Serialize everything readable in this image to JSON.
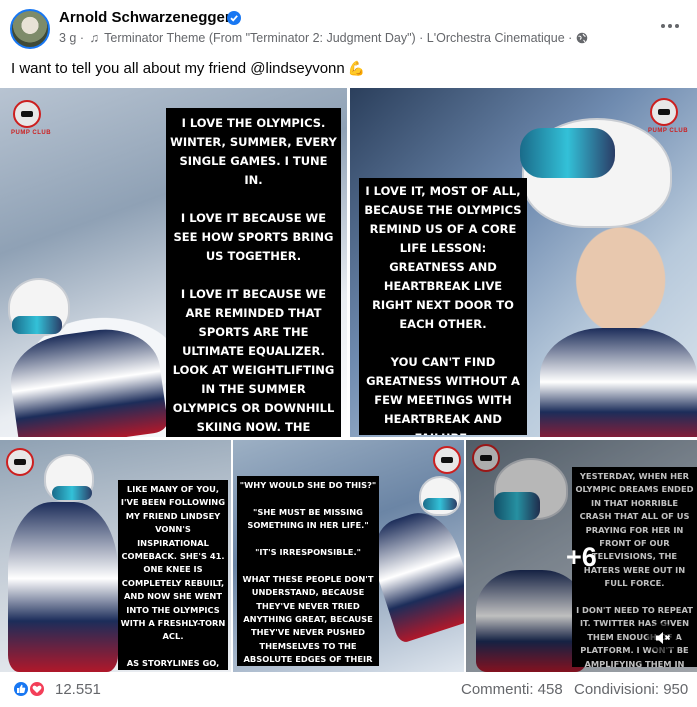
{
  "post": {
    "author": "Arnold Schwarzenegger",
    "meta_time": "3 g",
    "meta_music": "Terminator Theme (From \"Terminator 2: Judgment Day\") · L'Orchestra Cinematique",
    "separator": "·",
    "text": "I want to tell you all about my friend @lindseyvonn",
    "text_emoji": "💪"
  },
  "gallery": {
    "badge_text": "PUMP CLUB",
    "more_count": "+6",
    "tiles": [
      {
        "caption": "I LOVE THE OLYMPICS. WINTER, SUMMER, EVERY SINGLE GAMES. I TUNE IN.\n\nI LOVE IT BECAUSE WE SEE HOW SPORTS BRING US TOGETHER.\n\nI LOVE IT BECAUSE WE ARE REMINDED THAT SPORTS ARE THE ULTIMATE EQUALIZER. LOOK AT WEIGHTLIFTING IN THE SUMMER OLYMPICS OR DOWNHILL SKIING NOW. THE WEIGHTS AND THE MOUNTAIN DON'T CARE WHAT COUNTRY YOU COME FROM, HOW MUCH MONEY YOU HAVE, OR WHAT RELIGION YOU ARE. THE"
      },
      {
        "caption": "I LOVE IT, MOST OF ALL, BECAUSE THE OLYMPICS REMIND US OF A CORE LIFE LESSON: GREATNESS AND HEARTBREAK LIVE RIGHT NEXT DOOR TO EACH OTHER.\n\nYOU CAN'T FIND GREATNESS WITHOUT A FEW MEETINGS WITH HEARTBREAK AND FAILURE.\n\nWE SAW THIS VERY CLEARLY OVER THE WEEKEND"
      },
      {
        "caption": "LIKE MANY OF YOU, I'VE BEEN FOLLOWING MY FRIEND LINDSEY VONN'S INSPIRATIONAL COMEBACK. SHE'S 41. ONE KNEE IS COMPLETELY REBUILT, AND NOW SHE WENT INTO THE OLYMPICS WITH A FRESHLY-TORN ACL.\n\nAS STORYLINES GO, YOU CAN'T GET ANY BETTER. IT IS GUTSY. IT IS BRAVE. IT IS A LITTLE BIT CRAZY."
      },
      {
        "caption": "\"WHY WOULD SHE DO THIS?\"\n\n\"SHE MUST BE MISSING SOMETHING IN HER LIFE.\"\n\n\"IT'S IRRESPONSIBLE.\"\n\nWHAT THESE PEOPLE DON'T UNDERSTAND, BECAUSE THEY'VE NEVER TRIED ANYTHING GREAT, BECAUSE THEY'VE NEVER PUSHED THEMSELVES TO THE ABSOLUTE EDGES OF THEIR LIMITS, BECAUSE THEY'LL NEVER KNOW"
      },
      {
        "caption": "YESTERDAY, WHEN HER OLYMPIC DREAMS ENDED IN THAT HORRIBLE CRASH THAT ALL OF US PRAYING FOR HER IN FRONT OF OUR TELEVISIONS, THE HATERS WERE OUT IN FULL FORCE.\n\nI DON'T NEED TO REPEAT IT. TWITTER HAS GIVEN THEM ENOUGH OF A PLATFORM. I WON'T BE AMPLIFYING THEM IN THIS NEWSLETTER."
      }
    ]
  },
  "stats": {
    "reactions_count": "12.551",
    "comments": "Commenti: 458",
    "shares": "Condivisioni: 950"
  },
  "icons": {
    "verified": "verified-badge-icon",
    "music": "music-note-icon",
    "audience": "globe-icon",
    "more": "more-options-icon",
    "like": "like-reaction-icon",
    "love": "love-reaction-icon",
    "mute": "mute-icon"
  },
  "colors": {
    "accent": "#1877f2",
    "love": "#f33e58",
    "secondary_text": "#65676b"
  }
}
